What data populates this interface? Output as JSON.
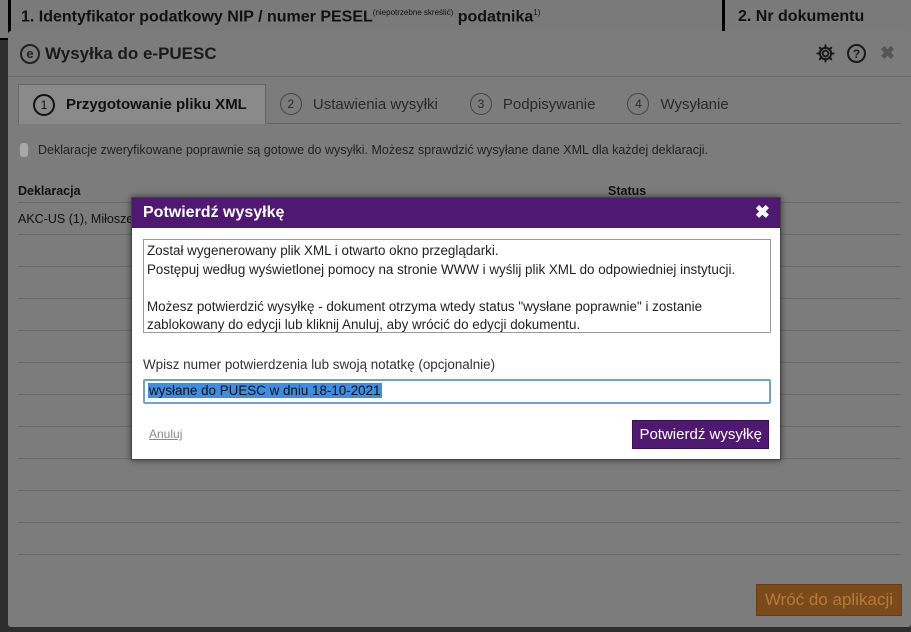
{
  "background_form": {
    "field1_title": "1. Identyfikator podatkowy NIP / numer PESEL",
    "field1_sup": "(niepotrzebne skreślić)",
    "field1_suffix": "podatnika",
    "field1_sup2": "1)",
    "field2_title": "2. Nr dokumentu"
  },
  "dialog": {
    "logo": "e",
    "title": "Wysyłka do e-PUESC",
    "tabs": [
      {
        "num": "1",
        "label": "Przygotowanie pliku XML",
        "active": true
      },
      {
        "num": "2",
        "label": "Ustawienia wysyłki",
        "active": false
      },
      {
        "num": "3",
        "label": "Podpisywanie",
        "active": false
      },
      {
        "num": "4",
        "label": "Wysyłanie",
        "active": false
      }
    ],
    "info": "Deklaracje zweryfikowane poprawnie są gotowe do wysyłki. Możesz sprawdzić wysyłane dane XML dla każdej deklaracji.",
    "table": {
      "headers": [
        "Deklaracja",
        "Status"
      ],
      "rows": [
        "AKC-US (1), Miłoszew"
      ]
    },
    "back_button": "Wróć do aplikacji"
  },
  "modal": {
    "title": "Potwierdź wysyłkę",
    "message": [
      "Został wygenerowany plik XML i otwarto okno przeglądarki.",
      "Postępuj według wyświetlonej pomocy na stronie WWW i wyślij plik XML do odpowiedniej instytucji.",
      "",
      "Możesz potwierdzić wysyłkę - dokument otrzyma wtedy status \"wysłane poprawnie\" i zostanie",
      "zablokowany do edycji lub kliknij Anuluj, aby wrócić do edycji dokumentu."
    ],
    "field_label": "Wpisz numer potwierdzenia lub swoją notatkę (opcjonalnie)",
    "field_value": "wysłane do PUESC w dniu 18-10-2021",
    "cancel_label": "Anuluj",
    "confirm_label": "Potwierdź wysyłkę"
  },
  "colors": {
    "accent": "#4f1871",
    "input_focus": "#6fa1d6"
  }
}
